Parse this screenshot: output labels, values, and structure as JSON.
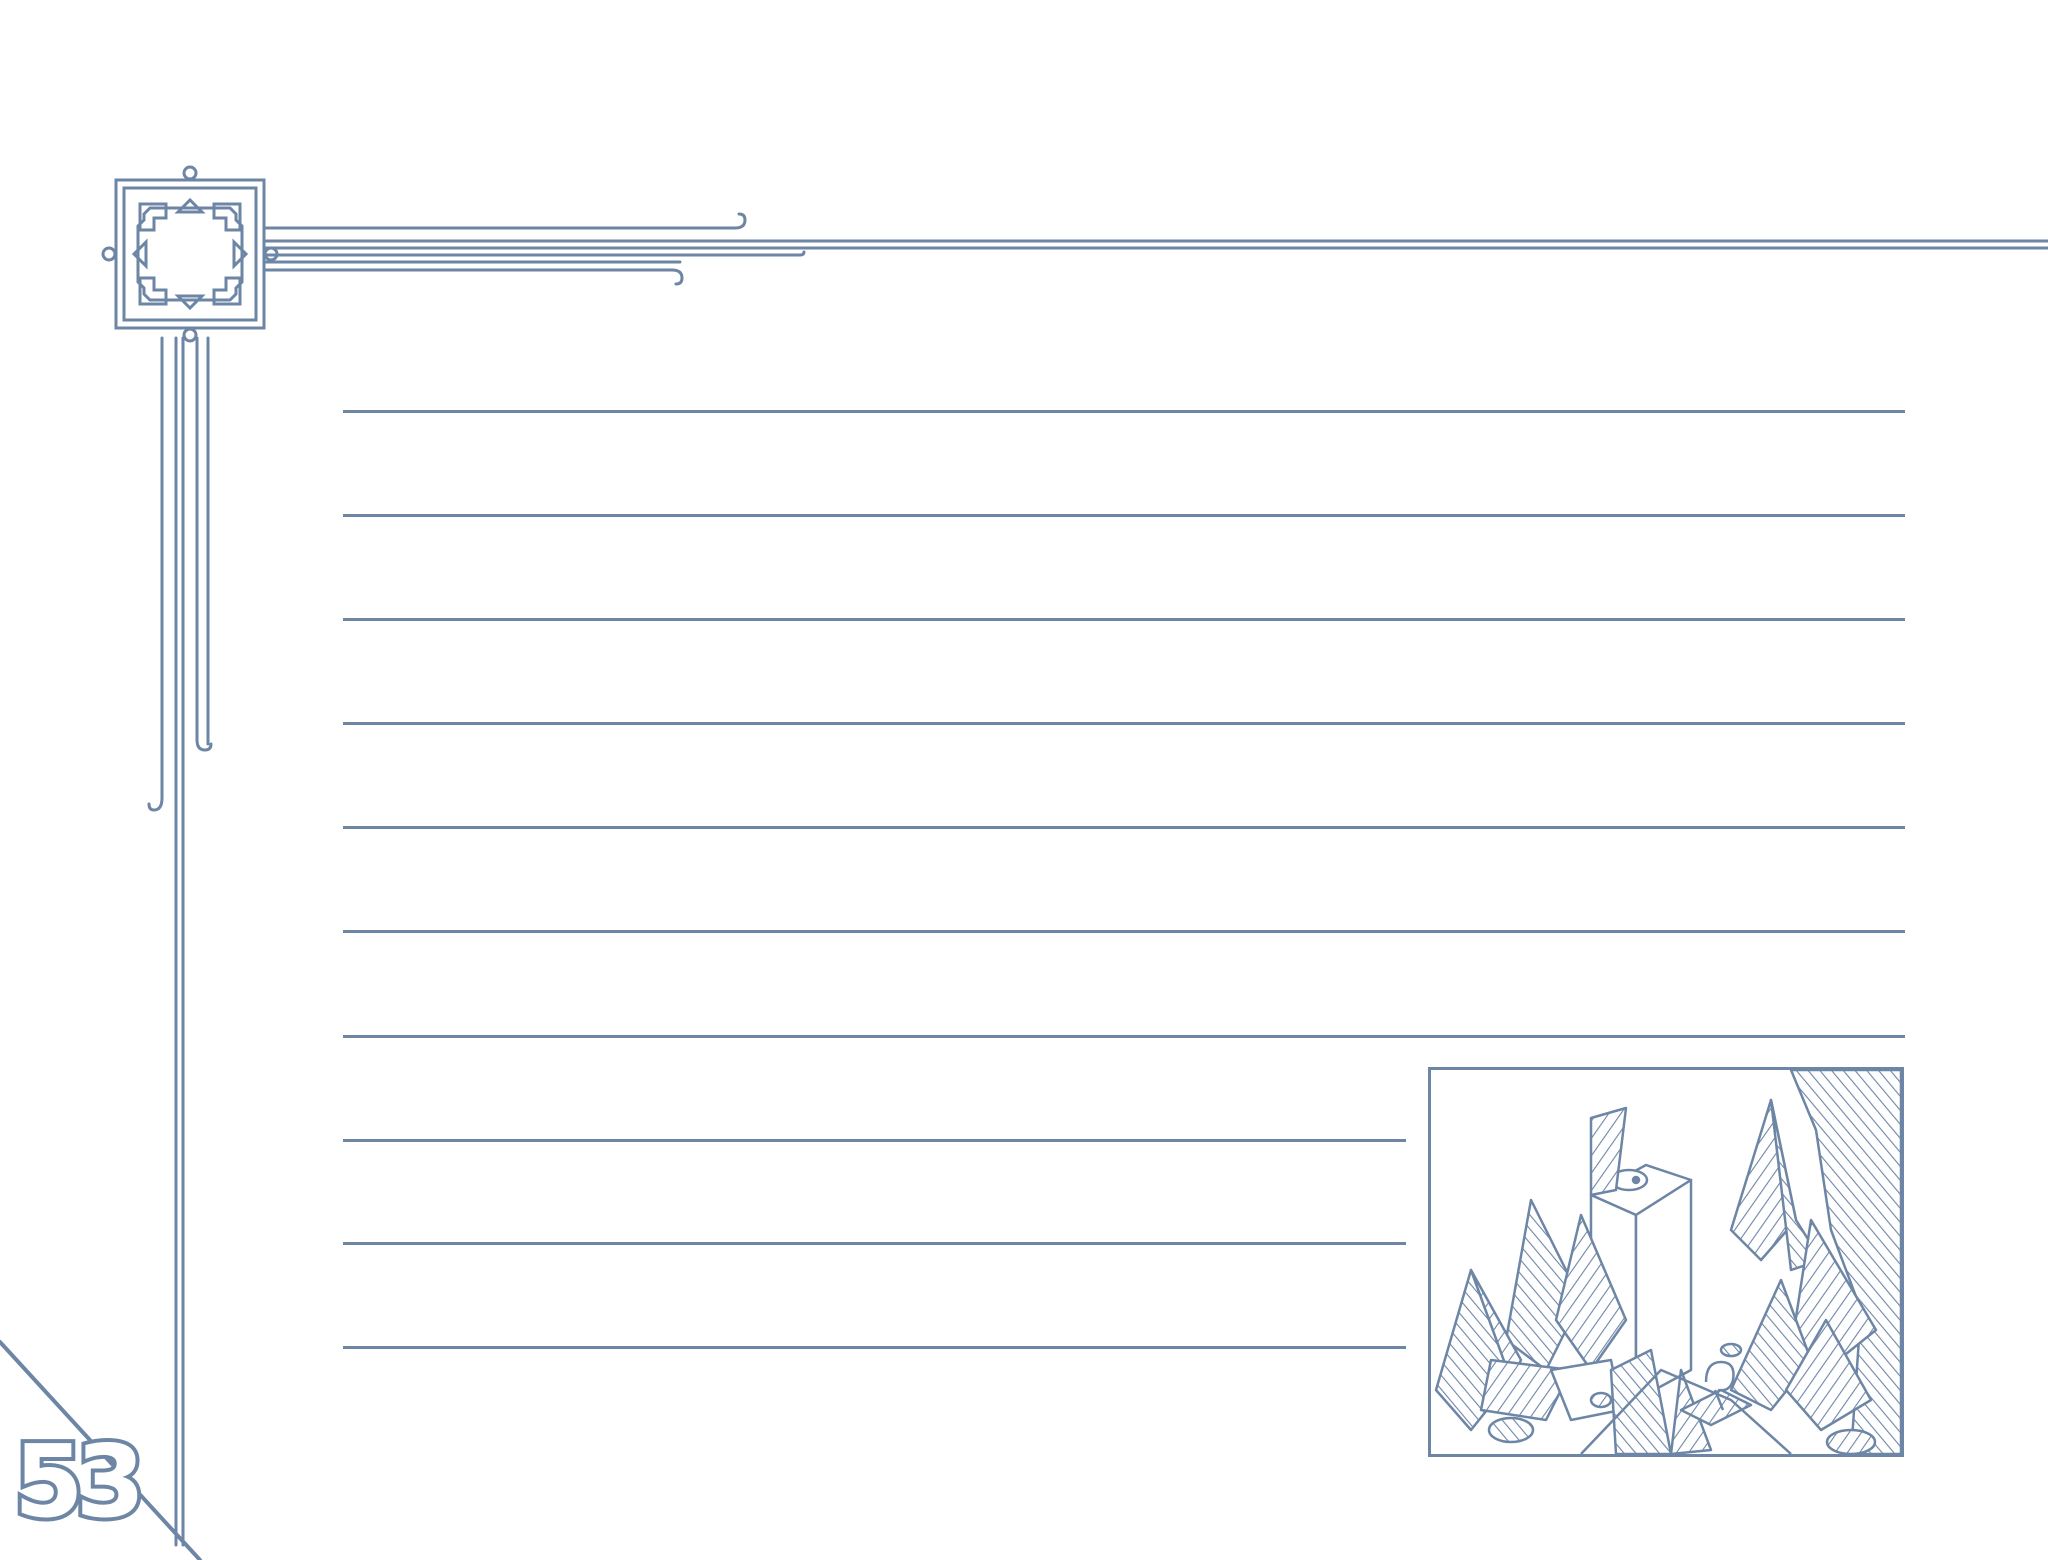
{
  "page": {
    "page_number": "53",
    "accent_color": "#6e86a6",
    "background_color": "#ffffff"
  },
  "ornament": {
    "icon": "art-deco-corner-medallion-icon"
  },
  "writing_area": {
    "full_width_lines": 7,
    "short_lines": 3
  },
  "illustration": {
    "icon": "crystal-formation-with-pillar-illustration"
  }
}
